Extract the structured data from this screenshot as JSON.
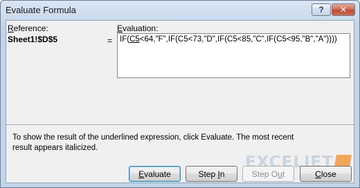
{
  "window": {
    "title": "Evaluate Formula",
    "help_glyph": "?",
    "close_glyph": "✕"
  },
  "reference": {
    "label": "Reference:",
    "value": "Sheet1!$D$5"
  },
  "equals": "=",
  "evaluation": {
    "label": "Evaluation:",
    "formula_prefix": "IF(",
    "formula_underlined": "C5",
    "formula_rest": "<64,\"F\",IF(C5<73,\"D\",IF(C5<85,\"C\",IF(C5<95,\"B\",\"A\"))))"
  },
  "description": "To show the result of the underlined expression, click Evaluate.  The most recent result appears italicized.",
  "watermark": "EXCELJET",
  "buttons": {
    "evaluate": "Evaluate",
    "step_in": "Step In",
    "step_out": "Step Out",
    "close": "Close"
  }
}
